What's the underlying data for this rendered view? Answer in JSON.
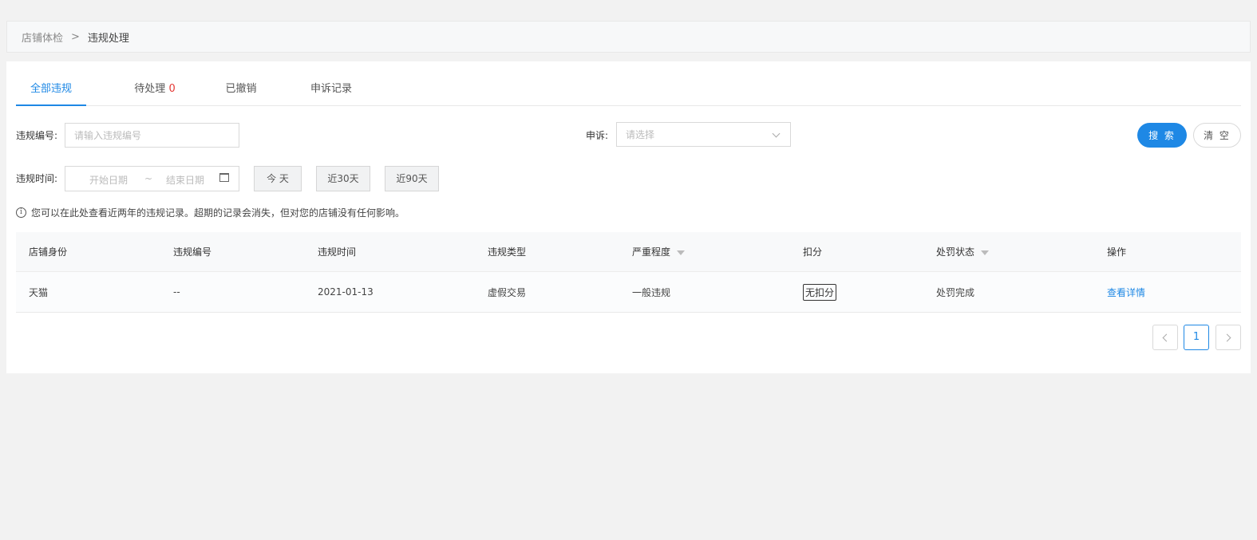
{
  "breadcrumb": {
    "parent": "店铺体检",
    "separator": ">",
    "current": "违规处理"
  },
  "tabs": [
    {
      "label": "全部违规",
      "count": ""
    },
    {
      "label": "待处理",
      "count": "0"
    },
    {
      "label": "已撤销",
      "count": ""
    },
    {
      "label": "申诉记录",
      "count": ""
    }
  ],
  "filters": {
    "id_label": "违规编号:",
    "id_placeholder": "请输入违规编号",
    "appeal_label": "申诉:",
    "appeal_placeholder": "请选择",
    "search_label": "搜 索",
    "clear_label": "清 空",
    "time_label": "违规时间:",
    "start_placeholder": "开始日期",
    "range_sep": "~",
    "end_placeholder": "结束日期",
    "quick": [
      "今 天",
      "近30天",
      "近90天"
    ]
  },
  "notice": "您可以在此处查看近两年的违规记录。超期的记录会消失，但对您的店铺没有任何影响。",
  "table": {
    "headers": [
      "店铺身份",
      "违规编号",
      "违规时间",
      "违规类型",
      "严重程度",
      "扣分",
      "处罚状态",
      "操作"
    ],
    "rows": [
      {
        "identity": "天猫",
        "id": "--",
        "time": "2021-01-13",
        "type": "虚假交易",
        "severity": "一般违规",
        "deduction": "无扣分",
        "status": "处罚完成",
        "action": "查看详情"
      }
    ]
  },
  "pagination": {
    "current": "1"
  },
  "colors": {
    "accent": "#1e88e5",
    "count": "#e53935"
  }
}
